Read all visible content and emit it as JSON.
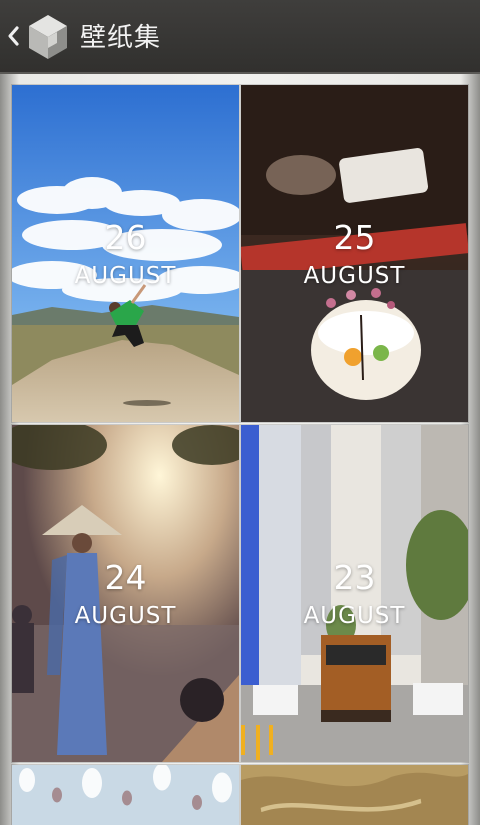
{
  "header": {
    "back_icon": "chevron-left-icon",
    "logo_icon": "cube-logo-icon",
    "title": "壁纸集"
  },
  "wallpapers": [
    {
      "day": "26",
      "month": "AUGUST"
    },
    {
      "day": "25",
      "month": "AUGUST"
    },
    {
      "day": "24",
      "month": "AUGUST"
    },
    {
      "day": "23",
      "month": "AUGUST"
    }
  ],
  "colors": {
    "actionbar": "#3a3937",
    "title_text": "#f2f2f2",
    "overlay_text": "#ffffff"
  }
}
